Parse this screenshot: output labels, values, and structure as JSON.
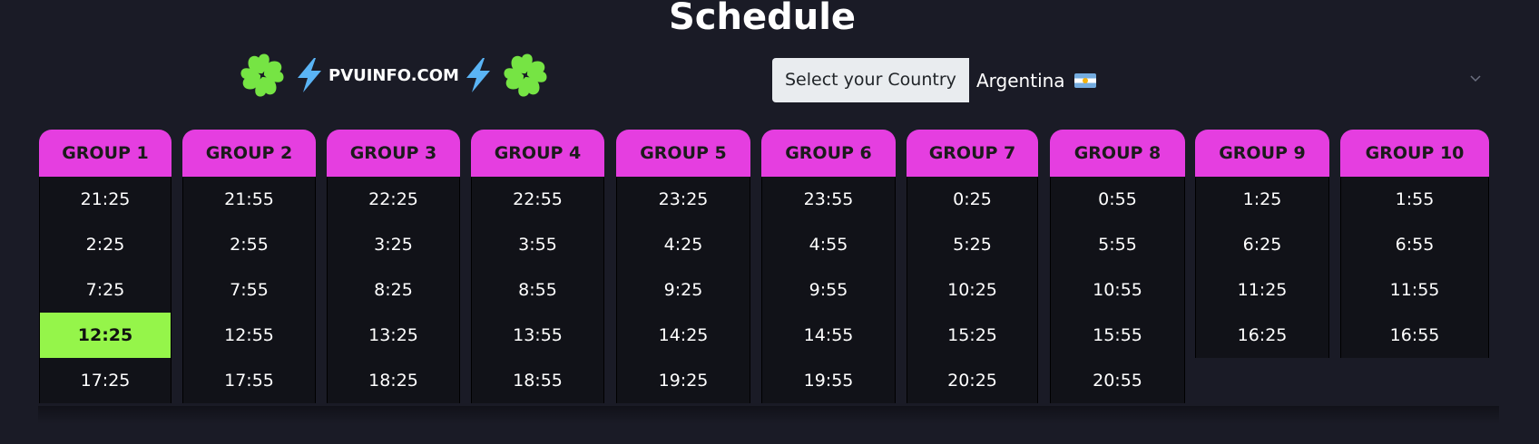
{
  "page": {
    "title": "Schedule"
  },
  "brand": {
    "text": "PVUINFO.COM",
    "left_icon": "four-leaf-clover-icon",
    "bolt_icon": "lightning-bolt-icon",
    "clover_color": "#76e444",
    "bolt_color": "#5ab4f5"
  },
  "country": {
    "label": "Select your Country",
    "selected": "Argentina",
    "flag": "argentina-flag-icon"
  },
  "colors": {
    "background": "#1a1b26",
    "group_header": "#e53ee0",
    "active_cell": "#95f54a"
  },
  "groups": [
    {
      "name": "GROUP 1",
      "times": [
        "21:25",
        "2:25",
        "7:25",
        "12:25",
        "17:25"
      ],
      "active_index": 3
    },
    {
      "name": "GROUP 2",
      "times": [
        "21:55",
        "2:55",
        "7:55",
        "12:55",
        "17:55"
      ]
    },
    {
      "name": "GROUP 3",
      "times": [
        "22:25",
        "3:25",
        "8:25",
        "13:25",
        "18:25"
      ]
    },
    {
      "name": "GROUP 4",
      "times": [
        "22:55",
        "3:55",
        "8:55",
        "13:55",
        "18:55"
      ]
    },
    {
      "name": "GROUP 5",
      "times": [
        "23:25",
        "4:25",
        "9:25",
        "14:25",
        "19:25"
      ]
    },
    {
      "name": "GROUP 6",
      "times": [
        "23:55",
        "4:55",
        "9:55",
        "14:55",
        "19:55"
      ]
    },
    {
      "name": "GROUP 7",
      "times": [
        "0:25",
        "5:25",
        "10:25",
        "15:25",
        "20:25"
      ]
    },
    {
      "name": "GROUP 8",
      "times": [
        "0:55",
        "5:55",
        "10:55",
        "15:55",
        "20:55"
      ]
    },
    {
      "name": "GROUP 9",
      "times": [
        "1:25",
        "6:25",
        "11:25",
        "16:25"
      ]
    },
    {
      "name": "GROUP 10",
      "times": [
        "1:55",
        "6:55",
        "11:55",
        "16:55"
      ]
    }
  ]
}
